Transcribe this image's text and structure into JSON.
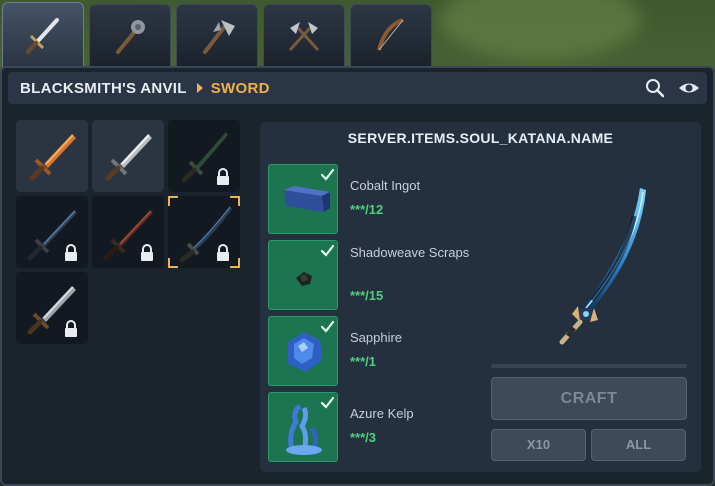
{
  "tabs": [
    {
      "icon": "sword-icon",
      "active": true
    },
    {
      "icon": "mace-icon",
      "active": false
    },
    {
      "icon": "battle-axe-icon",
      "active": false
    },
    {
      "icon": "dual-axes-icon",
      "active": false
    },
    {
      "icon": "bow-icon",
      "active": false
    }
  ],
  "header": {
    "crumb_station": "BLACKSMITH'S ANVIL",
    "crumb_category": "SWORD",
    "search_icon": "search-icon",
    "view_icon": "eye-icon"
  },
  "inventory": [
    {
      "name": "copper-sword",
      "locked": false,
      "selected": false
    },
    {
      "name": "iron-sword",
      "locked": false,
      "selected": false
    },
    {
      "name": "dark-sword",
      "locked": true,
      "selected": false
    },
    {
      "name": "shadow-blade",
      "locked": true,
      "selected": false
    },
    {
      "name": "crimson-blade",
      "locked": true,
      "selected": false
    },
    {
      "name": "soul-katana",
      "locked": true,
      "selected": true
    },
    {
      "name": "bone-sword",
      "locked": true,
      "selected": false
    }
  ],
  "recipe": {
    "title": "SERVER.ITEMS.SOUL_KATANA.NAME",
    "ingredients": [
      {
        "name": "Cobalt Ingot",
        "qty": "***/12",
        "icon": "cobalt-ingot-icon"
      },
      {
        "name": "Shadoweave Scraps",
        "qty": "***/15",
        "icon": "shadoweave-scraps-icon"
      },
      {
        "name": "Sapphire",
        "qty": "***/1",
        "icon": "sapphire-icon"
      },
      {
        "name": "Azure Kelp",
        "qty": "***/3",
        "icon": "azure-kelp-icon"
      }
    ],
    "craft_label": "CRAFT",
    "x10_label": "X10",
    "all_label": "ALL"
  },
  "colors": {
    "accent": "#f0b14a",
    "ingredient_ok": "#1d7450",
    "qty_text": "#4fd07f"
  }
}
